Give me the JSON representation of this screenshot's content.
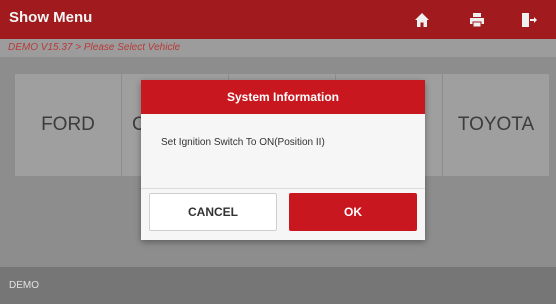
{
  "header": {
    "title": "Show Menu",
    "icons": [
      "home-icon",
      "print-icon",
      "exit-icon"
    ]
  },
  "breadcrumb": "DEMO V15.37 > Please Select  Vehicle",
  "tiles": [
    {
      "label": "FORD"
    },
    {
      "label": "C"
    },
    {
      "label": ""
    },
    {
      "label": ""
    },
    {
      "label": "TOYOTA"
    }
  ],
  "footer": {
    "label": "DEMO"
  },
  "dialog": {
    "title": "System Information",
    "message": "Set Ignition Switch To ON(Position II)",
    "cancel_label": "CANCEL",
    "ok_label": "OK"
  },
  "colors": {
    "brand_red": "#a11a1d",
    "dialog_red": "#c8171e"
  }
}
